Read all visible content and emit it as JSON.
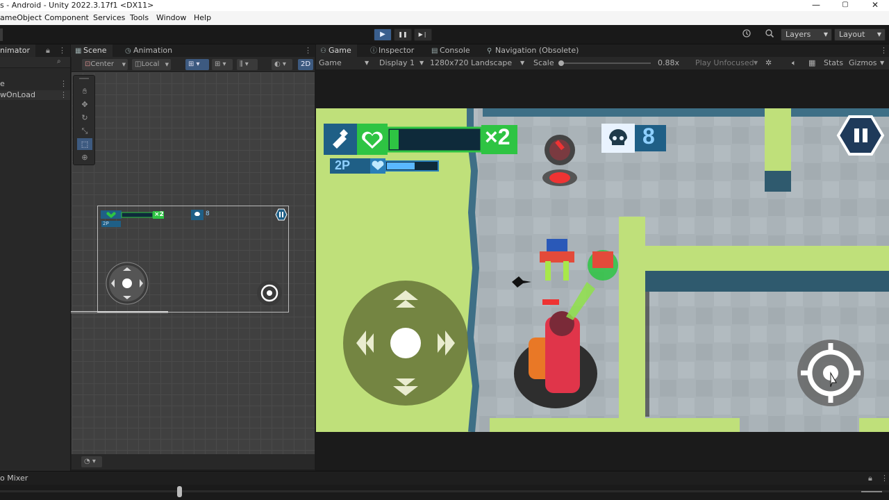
{
  "window": {
    "title": "s - Android - Unity 2022.3.17f1 <DX11>",
    "minimize": "—",
    "maximize": "▢",
    "close": "✕"
  },
  "menu": [
    "ameObject",
    "Component",
    "Services",
    "Tools",
    "Window",
    "Help"
  ],
  "toolbar": {
    "play": "▶",
    "pause": "❚❚",
    "step": "▶❘",
    "layers": "Layers",
    "layout": "Layout"
  },
  "left_panel": {
    "tab": "nimator",
    "rows": [
      "e",
      "wOnLoad"
    ]
  },
  "scene": {
    "tab_scene": "Scene",
    "tab_animation": "Animation",
    "pivot": "Center",
    "space": "Local",
    "mode_2d": "2D"
  },
  "game_tabs": {
    "game": "Game",
    "inspector": "Inspector",
    "console": "Console",
    "navigation": "Navigation (Obsolete)"
  },
  "game_toolbar": {
    "mode": "Game",
    "display": "Display 1",
    "resolution": "1280x720 Landscape",
    "scale_label": "Scale",
    "scale_value": "0.88x",
    "play_unfocused": "Play Unfocused",
    "stats": "Stats",
    "gizmos": "Gizmos"
  },
  "hud": {
    "lives": "×2",
    "player2": "2P",
    "kills": "8"
  },
  "scene_hud": {
    "lives": "×2",
    "player2": "2P",
    "kills": "8"
  },
  "health": {
    "p1": 0.1,
    "p2": 0.55
  },
  "bottom": {
    "audio_mixer": "o Mixer"
  },
  "colors": {
    "accent": "#3a5f8e",
    "grass": "#bfe07a",
    "floor": "#aab3b8",
    "hud_blue": "#1f5f86",
    "hud_green": "#2ec443",
    "wall": "#3e6f86"
  }
}
